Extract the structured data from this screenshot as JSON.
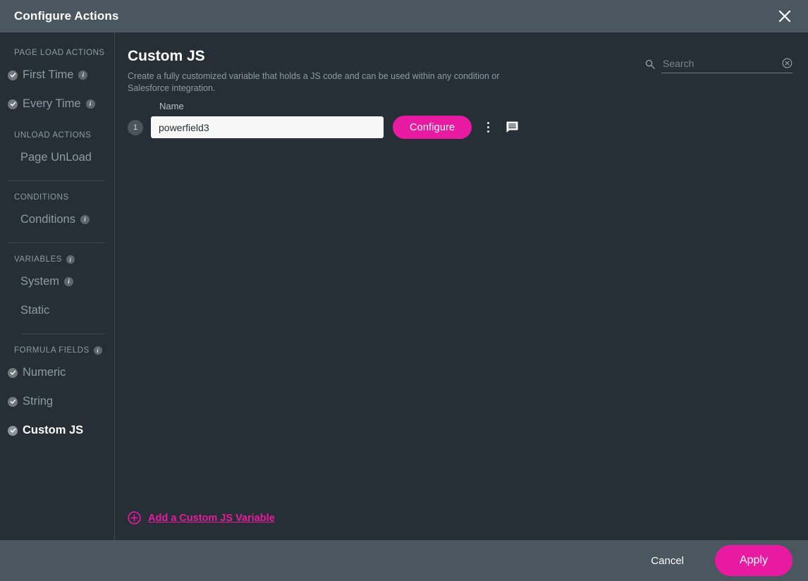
{
  "window": {
    "title": "Configure Actions",
    "close_icon": "close-icon"
  },
  "sidebar": {
    "sections": [
      {
        "heading": "PAGE LOAD ACTIONS",
        "heading_info": false,
        "items": [
          {
            "label": "First Time",
            "checked": true,
            "info": true,
            "active": false
          },
          {
            "label": "Every Time",
            "checked": true,
            "info": true,
            "active": false
          }
        ]
      },
      {
        "heading": "UNLOAD ACTIONS",
        "heading_info": false,
        "items": [
          {
            "label": "Page UnLoad",
            "checked": false,
            "info": false,
            "active": false
          }
        ]
      },
      {
        "heading": "CONDITIONS",
        "heading_info": false,
        "items": [
          {
            "label": "Conditions",
            "checked": false,
            "info": true,
            "active": false
          }
        ]
      },
      {
        "heading": "VARIABLES",
        "heading_info": true,
        "items": [
          {
            "label": "System",
            "checked": false,
            "info": true,
            "active": false
          },
          {
            "label": "Static",
            "checked": false,
            "info": false,
            "active": false
          }
        ]
      },
      {
        "heading": "FORMULA FIELDS",
        "heading_info": true,
        "items": [
          {
            "label": "Numeric",
            "checked": true,
            "info": false,
            "active": false
          },
          {
            "label": "String",
            "checked": true,
            "info": false,
            "active": false
          },
          {
            "label": "Custom JS",
            "checked": true,
            "info": false,
            "active": true
          }
        ]
      }
    ]
  },
  "main": {
    "title": "Custom JS",
    "description": "Create a fully customized variable that holds a JS code and can be used within any condition or Salesforce integration.",
    "search": {
      "placeholder": "Search",
      "value": "",
      "icon": "search-icon",
      "clear_icon": "clear-circle-icon"
    },
    "name_column_label": "Name",
    "rows": [
      {
        "index": "1",
        "name_value": "powerfield3",
        "configure_label": "Configure",
        "menu_icon": "kebab-menu-icon",
        "comment_icon": "comment-icon"
      }
    ],
    "add_link": {
      "label": "Add a Custom JS Variable",
      "icon": "plus-circle-icon"
    }
  },
  "footer": {
    "cancel_label": "Cancel",
    "apply_label": "Apply"
  },
  "colors": {
    "accent": "#e81aa1",
    "titlebar": "#4b575f",
    "background": "#262f35",
    "muted_text": "#8d9ba2"
  }
}
